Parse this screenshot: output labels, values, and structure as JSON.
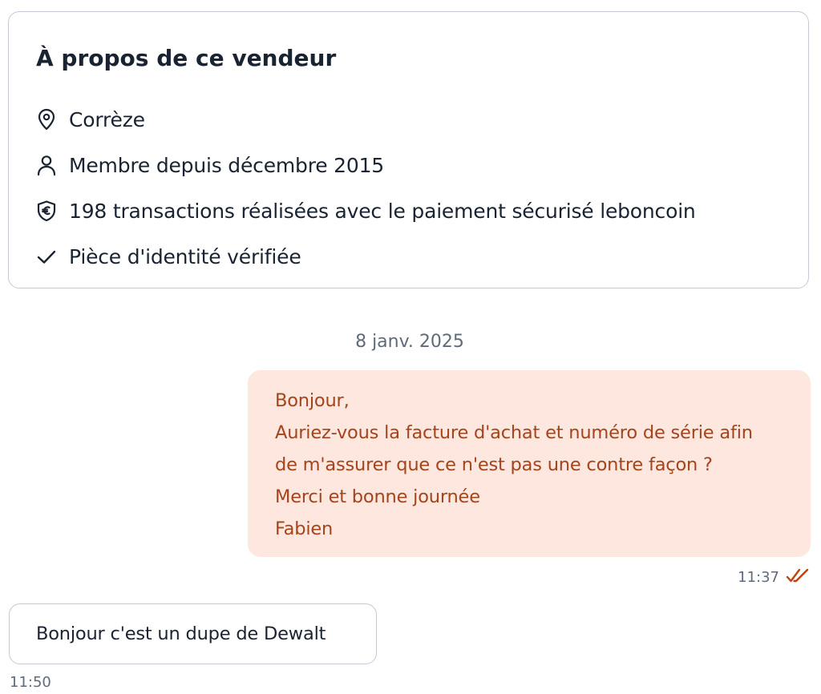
{
  "seller": {
    "title": "À propos de ce vendeur",
    "location": {
      "icon": "location-pin-icon",
      "text": "Corrèze"
    },
    "member_since": {
      "icon": "user-icon",
      "text": "Membre depuis décembre 2015"
    },
    "transactions": {
      "icon": "euro-shield-icon",
      "text": "198 transactions réalisées avec le paiement sécurisé leboncoin"
    },
    "identity": {
      "icon": "check-icon",
      "text": "Pièce d'identité vérifiée"
    }
  },
  "conversation": {
    "date_separator": "8 janv. 2025",
    "outgoing": {
      "lines": [
        "Bonjour,",
        "Auriez-vous la facture d'achat et numéro de série afin",
        "de m'assurer que ce n'est pas une contre façon ?",
        "Merci et bonne journée",
        "Fabien"
      ],
      "time": "11:37",
      "status_icon": "double-check-read-icon"
    },
    "incoming": {
      "text": "Bonjour c'est un dupe de Dewalt",
      "time": "11:50"
    }
  },
  "colors": {
    "outgoing_bubble_bg": "#fde7df",
    "outgoing_text": "#a4441b",
    "read_receipt": "#c2410c",
    "border": "#c3cad4",
    "primary_text": "#1a2332",
    "secondary_text": "#5f6b7a"
  }
}
